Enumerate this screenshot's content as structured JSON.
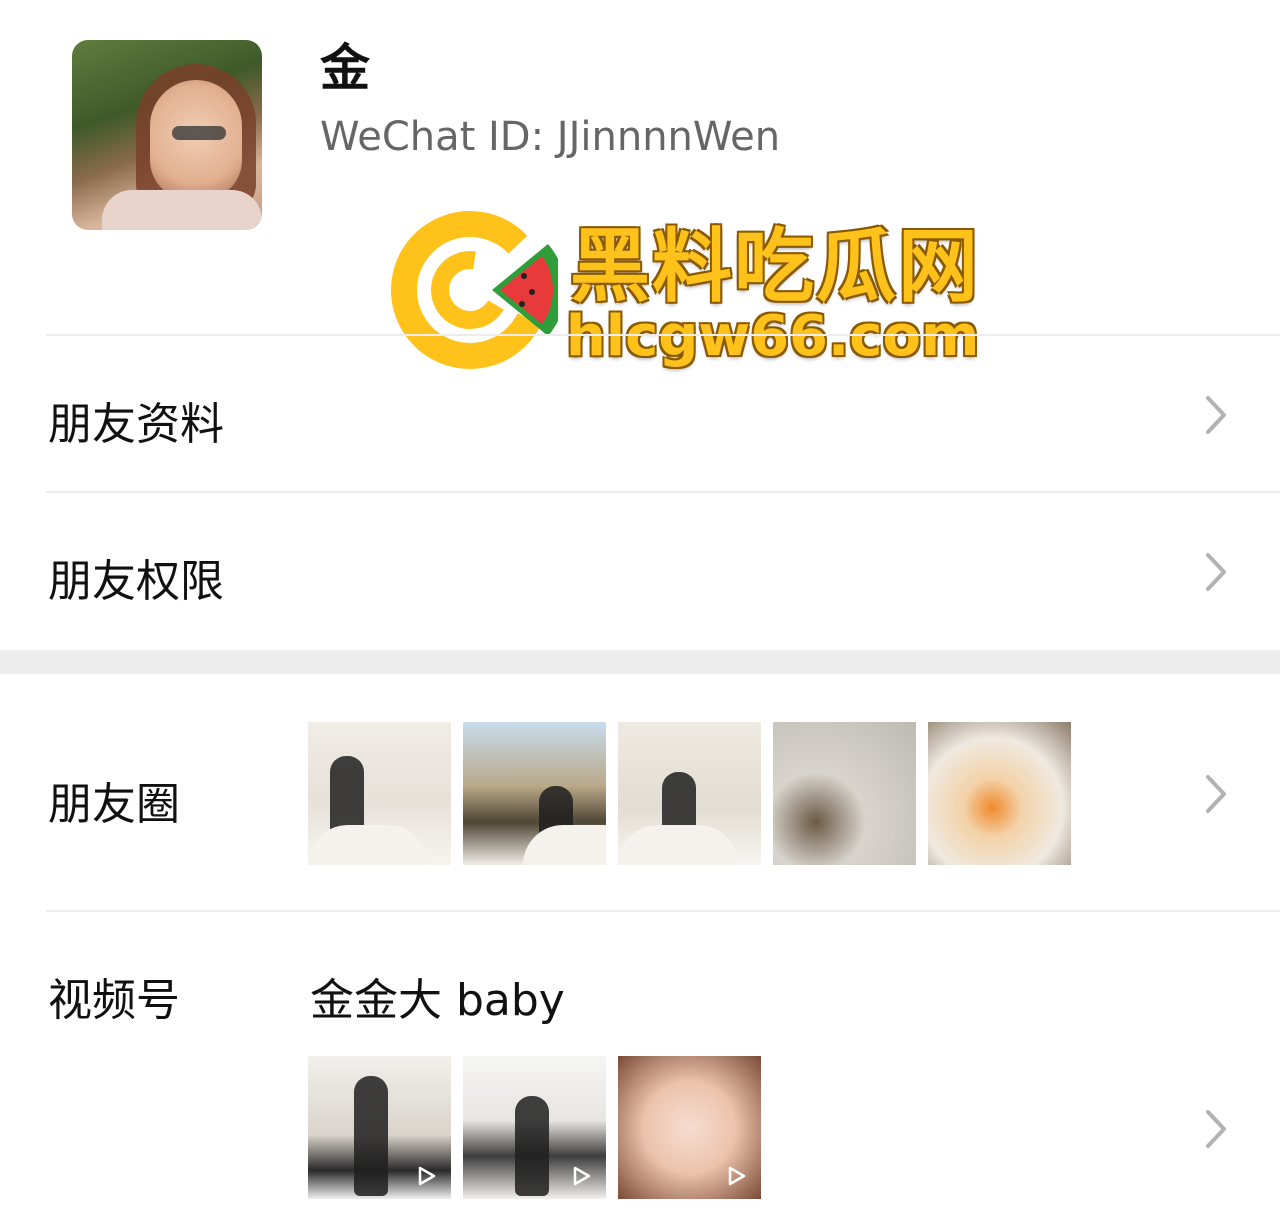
{
  "profile": {
    "name": "金",
    "wechat_id": "WeChat ID: JJinnnnWen"
  },
  "watermark": {
    "title": "黑料吃瓜网",
    "url": "hlcgw66.com"
  },
  "rows": {
    "friend_info": "朋友资料",
    "friend_permissions": "朋友权限",
    "moments": "朋友圈",
    "channels": "视频号",
    "channel_name": "金金大 baby"
  },
  "icons": {
    "chevron": "chevron-right-icon",
    "play": "play-icon"
  },
  "colors": {
    "watermark_yellow": "#ffc21a",
    "divider": "#ececec",
    "section_gap": "#ededed",
    "chevron": "#b2b2b2"
  }
}
